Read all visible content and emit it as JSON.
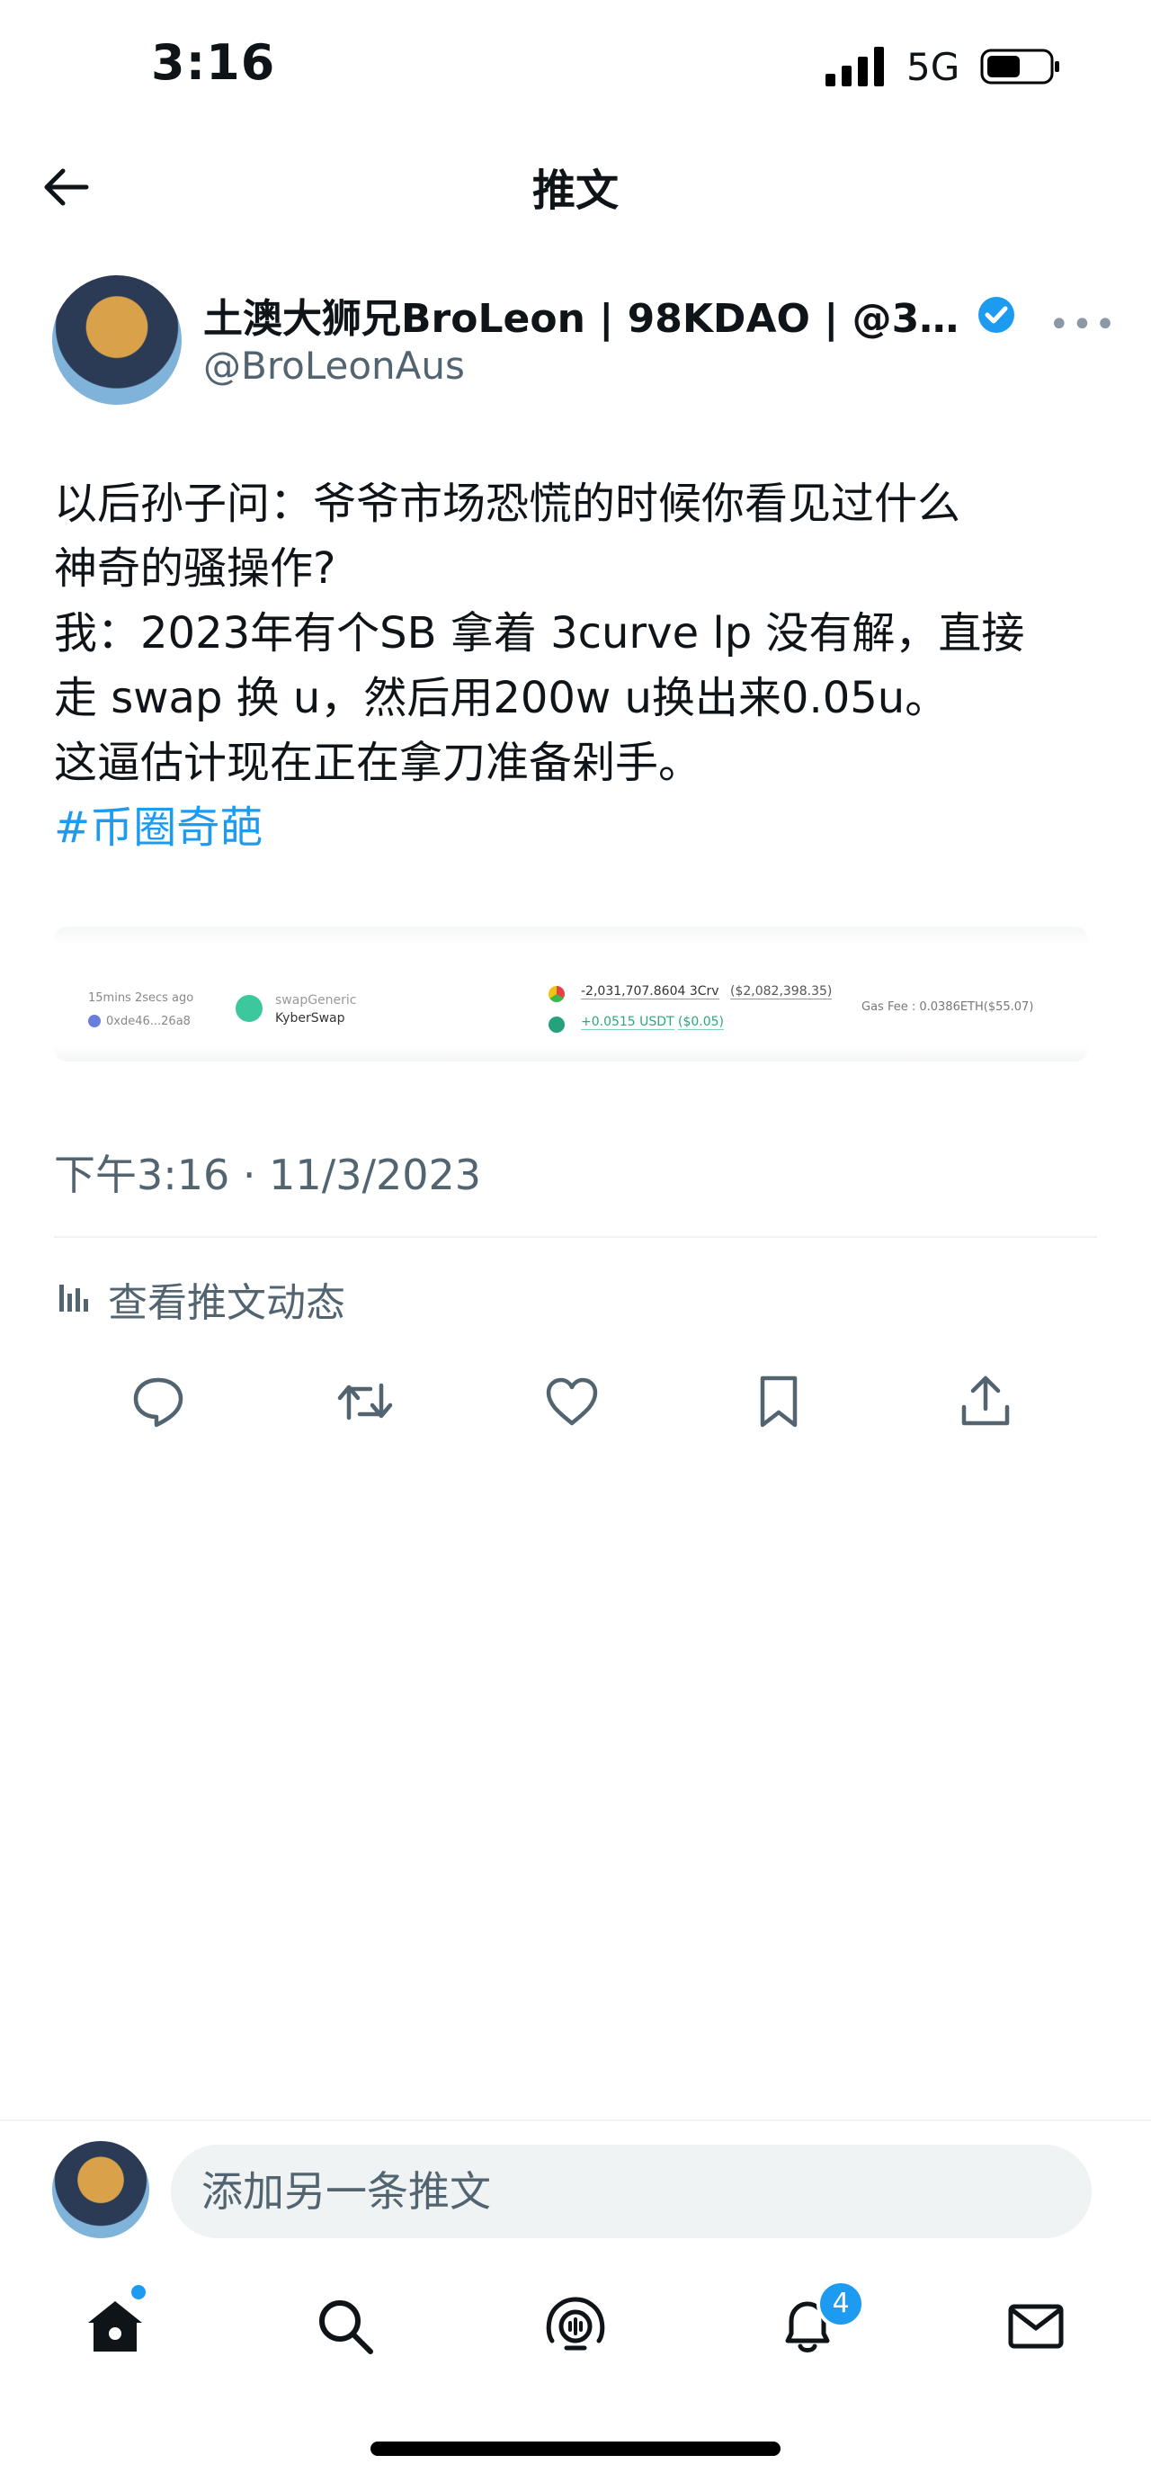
{
  "status_bar": {
    "time": "3:16",
    "network": "5G"
  },
  "header": {
    "title": "推文"
  },
  "author": {
    "name": "土澳大狮兄BroLeon | 98KDAO | @385...",
    "handle": "@BroLeonAus"
  },
  "tweet": {
    "lines": [
      "以后孙子问：爷爷市场恐慌的时候你看见过什么",
      "神奇的骚操作?",
      "我：2023年有个SB 拿着 3curve lp 没有解，直接",
      "走 swap 换 u，然后用200w u换出来0.05u。",
      "这逼估计现在正在拿刀准备剁手。"
    ],
    "hashtag": "#币圈奇葩"
  },
  "media": {
    "time_ago": "15mins 2secs ago",
    "address": "0xde46...26a8",
    "type": "swapGeneric",
    "protocol": "KyberSwap",
    "out_amount": "-2,031,707.8604 3Crv",
    "out_value": "($2,082,398.35)",
    "in_amount": "+0.0515 USDT",
    "in_value": "($0.05)",
    "gas": "Gas Fee : 0.0386ETH($55.07)"
  },
  "meta": {
    "timestamp": "下午3:16 · 11/3/2023",
    "analytics_label": "查看推文动态"
  },
  "reply": {
    "placeholder": "添加另一条推文"
  },
  "nav": {
    "notification_count": "4"
  },
  "colors": {
    "accent": "#1d9bf0",
    "secondary_text": "#536471",
    "divider": "#eff3f4"
  }
}
